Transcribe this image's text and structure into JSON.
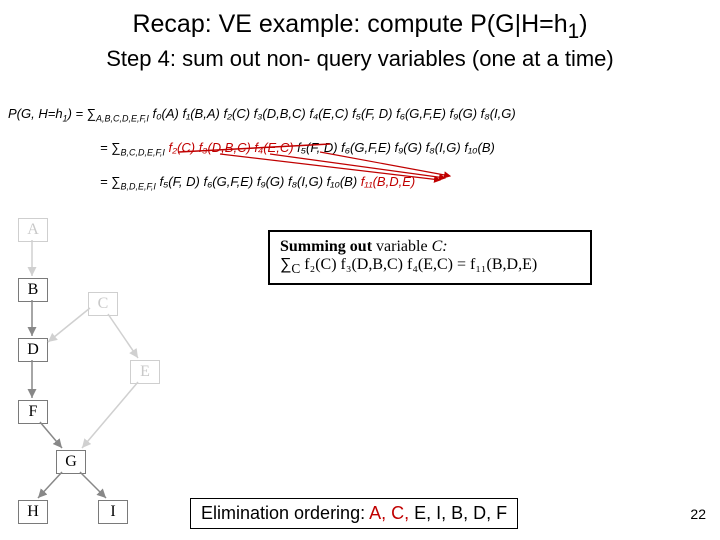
{
  "title_prefix": "Recap: VE example: compute ",
  "title_expr": "P(G|H=h",
  "title_sub": "1",
  "title_close": ")",
  "subtitle": "Step 4: sum out non- query variables (one at a time)",
  "eq1_lhs": "P(G, H=h",
  "eq1_lhs_sub": "1",
  "eq1_lhs_close": ") = ",
  "eq1_sum_sub": "A,B,C,D,E,F,I",
  "eq1_rest": " f₀(A) f₁(B,A) f₂(C) f₃(D,B,C) f₄(E,C) f₅(F, D) f₆(G,F,E) f₉(G) f₈(I,G)",
  "eq2_prefix": "= ",
  "eq2_sum_sub": "B,C,D,E,F,I",
  "eq2_a": " f₂(C) f₃(D,B,C) f₄(E,C)",
  "eq2_b": " f₅(F, D) f₆(G,F,E) f₉(G) f₈(I,G) f₁₀(B)",
  "eq3_prefix": "= ",
  "eq3_sum_sub": "B,D,E,F,I",
  "eq3_a": " f₅(F, D) f₆(G,F,E) f₉(G) f₈(I,G) f₁₀(B) ",
  "eq3_new": "f₁₁(B,D,E)",
  "box_line1a": "Summing out",
  "box_line1b": " variable ",
  "box_line1c": "C:",
  "box_line2_sub": "C",
  "box_line2_rest": " f₂(C) f₃(D,B,C) f₄(E,C) = f₁₁(B,D,E)",
  "nodes": {
    "A": "A",
    "B": "B",
    "C": "C",
    "D": "D",
    "E": "E",
    "F": "F",
    "G": "G",
    "H": "H",
    "I": "I"
  },
  "elim_label": "Elimination ordering: ",
  "elim_done": "A, C,",
  "elim_rest": " E, I, B, D, F",
  "pagenum": "22",
  "sigma": "∑"
}
